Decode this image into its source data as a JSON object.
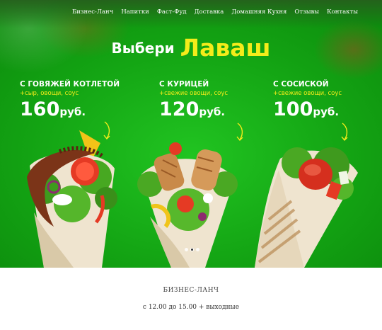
{
  "nav": {
    "items": [
      "Бизнес-Ланч",
      "Напитки",
      "Фаст-Фуд",
      "Доставка",
      "Домашняя Кухня",
      "Отзывы",
      "Контакты"
    ]
  },
  "headline": {
    "word1": "Выбери",
    "word2": "Лаваш"
  },
  "offers": [
    {
      "title": "С говяжей котлетой",
      "subtitle": "+сыр, овощи, соус",
      "price": "160",
      "currency": "руб."
    },
    {
      "title": "С курицей",
      "subtitle": "+свежие овощи, соус",
      "price": "120",
      "currency": "руб."
    },
    {
      "title": "С сосиской",
      "subtitle": "+свежие овощи, соус",
      "price": "100",
      "currency": "руб."
    }
  ],
  "slider": {
    "dots": 3,
    "active": 1
  },
  "section": {
    "title": "БИЗНЕС-ЛАНЧ",
    "subtitle": "с 12.00 до 15.00 + выходные"
  },
  "colors": {
    "hero_green": "#13a313",
    "accent_yellow": "#f4ec1a"
  },
  "icons": [
    "curved-arrow-icon"
  ]
}
